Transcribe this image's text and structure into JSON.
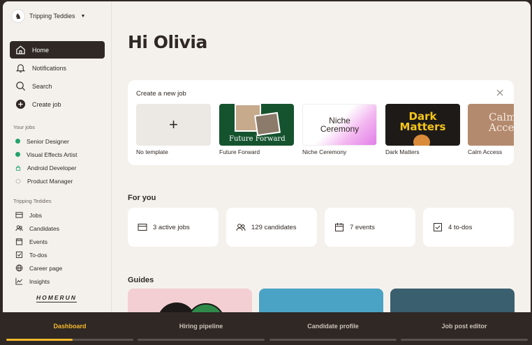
{
  "sidebar": {
    "org_name": "Tripping Teddies",
    "nav": [
      {
        "label": "Home",
        "icon": "home-icon",
        "active": true
      },
      {
        "label": "Notifications",
        "icon": "bell-icon"
      },
      {
        "label": "Search",
        "icon": "search-icon"
      },
      {
        "label": "Create job",
        "icon": "plus-circle-icon"
      }
    ],
    "your_jobs_label": "Your jobs",
    "jobs": [
      {
        "label": "Senior Designer",
        "icon": "status-dot-green"
      },
      {
        "label": "Visual Effects Artist",
        "icon": "status-dot-green"
      },
      {
        "label": "Android Developer",
        "icon": "lock-icon"
      },
      {
        "label": "Product Manager",
        "icon": "draft-dashed-circle-icon"
      }
    ],
    "company_label": "Tripping Teddies",
    "company_links": [
      {
        "label": "Jobs",
        "icon": "jobs-icon"
      },
      {
        "label": "Candidates",
        "icon": "candidates-icon"
      },
      {
        "label": "Events",
        "icon": "calendar-icon"
      },
      {
        "label": "To-dos",
        "icon": "checkbox-icon"
      },
      {
        "label": "Career page",
        "icon": "globe-icon"
      },
      {
        "label": "Insights",
        "icon": "chart-line-icon"
      }
    ],
    "brand": "HOMERUN"
  },
  "main": {
    "greeting": "Hi Olivia",
    "create_job": {
      "title": "Create a new job",
      "templates": [
        {
          "label": "No template",
          "thumb_text": "+"
        },
        {
          "label": "Future Forward",
          "thumb_text": "Future Forward"
        },
        {
          "label": "Niche Ceremony",
          "thumb_text": "Niche Ceremony"
        },
        {
          "label": "Dark Matters",
          "thumb_text": "Dark Matters"
        },
        {
          "label": "Calm Access",
          "thumb_text": "Calm Acce"
        }
      ]
    },
    "for_you": {
      "title": "For you",
      "stats": [
        {
          "label": "3 active jobs",
          "icon": "jobs-icon"
        },
        {
          "label": "129 candidates",
          "icon": "candidates-icon"
        },
        {
          "label": "7 events",
          "icon": "calendar-icon"
        },
        {
          "label": "4 to-dos",
          "icon": "checkbox-icon"
        }
      ]
    },
    "guides": {
      "title": "Guides",
      "colors": [
        "#f3cfd3",
        "#4aa3c4",
        "#3a5f6f"
      ]
    }
  },
  "tabs": [
    {
      "label": "Dashboard",
      "active": true,
      "progress": 0.52
    },
    {
      "label": "Hiring pipeline",
      "active": false,
      "progress": 0
    },
    {
      "label": "Candidate profile",
      "active": false,
      "progress": 0
    },
    {
      "label": "Job post editor",
      "active": false,
      "progress": 0
    }
  ],
  "colors": {
    "accent": "#f5b82e",
    "dark": "#2f2824",
    "status_green": "#22a36b"
  }
}
